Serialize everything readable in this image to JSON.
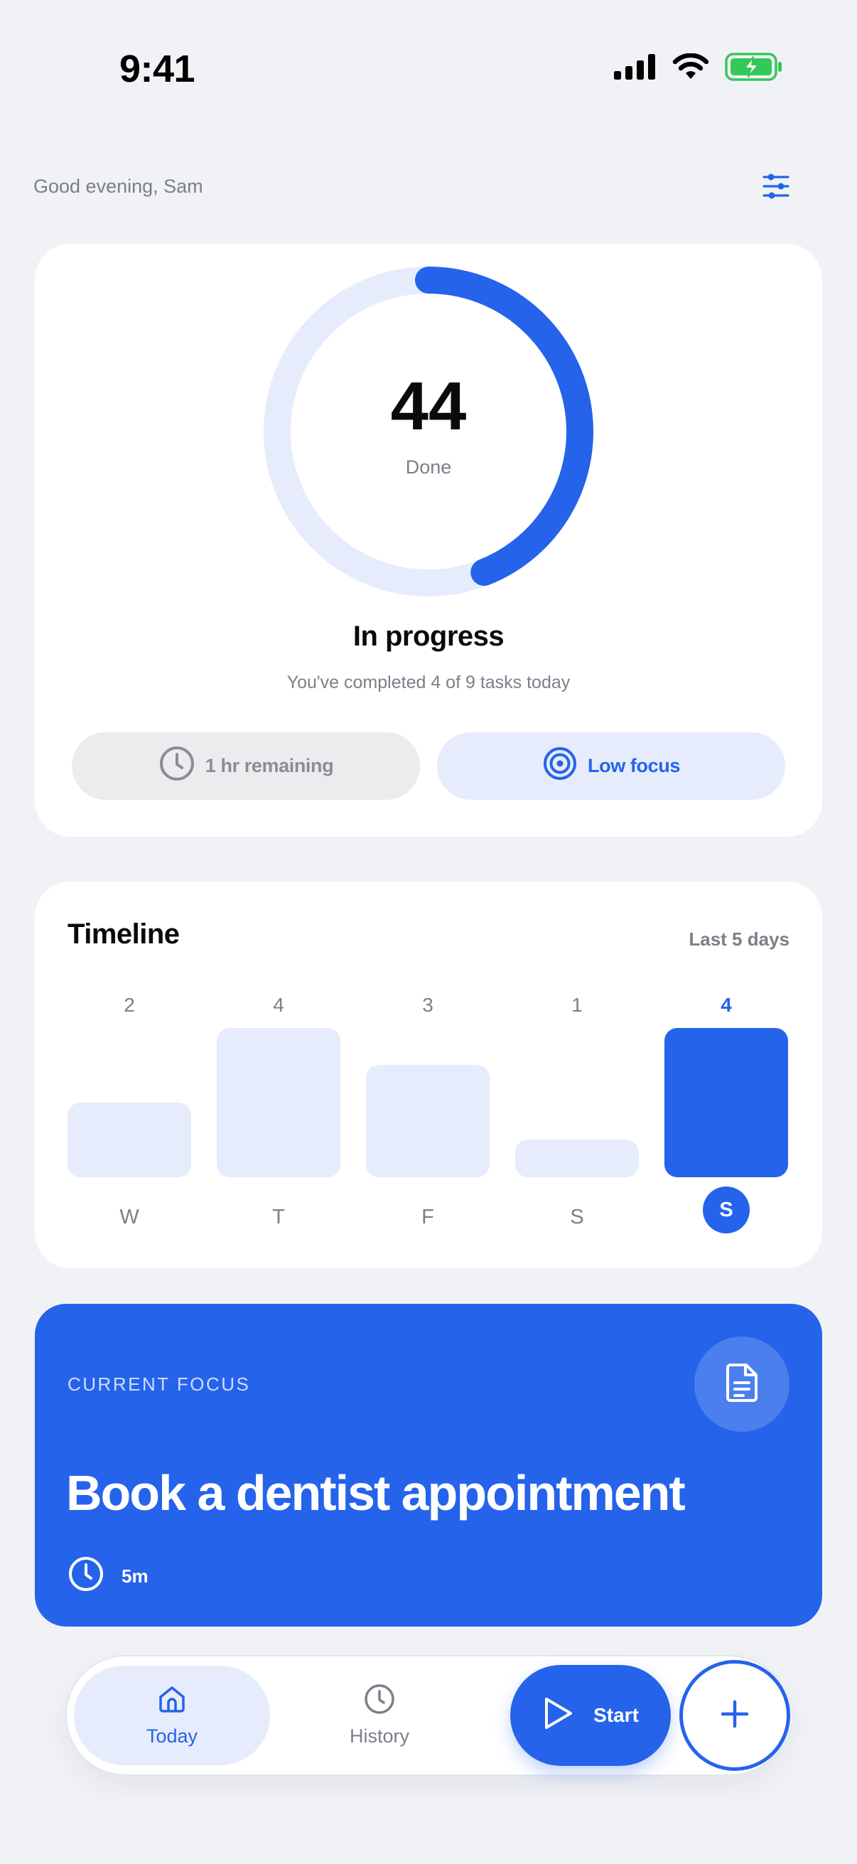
{
  "status_bar": {
    "time": "9:41"
  },
  "header": {
    "greeting": "Good evening, Sam"
  },
  "progress": {
    "value": "44",
    "value_label": "Done",
    "ring_fraction": 0.44,
    "title": "In progress",
    "subtitle": "You've completed 4 of 9 tasks today",
    "remaining_label": "1 hr remaining",
    "focus_label": "Low focus"
  },
  "timeline": {
    "title": "Timeline",
    "range": "Last 5 days",
    "days": [
      {
        "day": "W",
        "count": "2",
        "value": 2,
        "active": false
      },
      {
        "day": "T",
        "count": "4",
        "value": 4,
        "active": false
      },
      {
        "day": "F",
        "count": "3",
        "value": 3,
        "active": false
      },
      {
        "day": "S",
        "count": "1",
        "value": 1,
        "active": false
      },
      {
        "day": "S",
        "count": "4",
        "value": 4,
        "active": true
      }
    ]
  },
  "focus": {
    "eyebrow": "CURRENT FOCUS",
    "title": "Book a dentist appointment",
    "duration": "5m"
  },
  "nav": {
    "today": "Today",
    "history": "History",
    "start": "Start"
  },
  "colors": {
    "accent": "#2563EB",
    "accent_soft": "#E6ECFB",
    "background": "#F1F2F6",
    "battery": "#34C759"
  }
}
